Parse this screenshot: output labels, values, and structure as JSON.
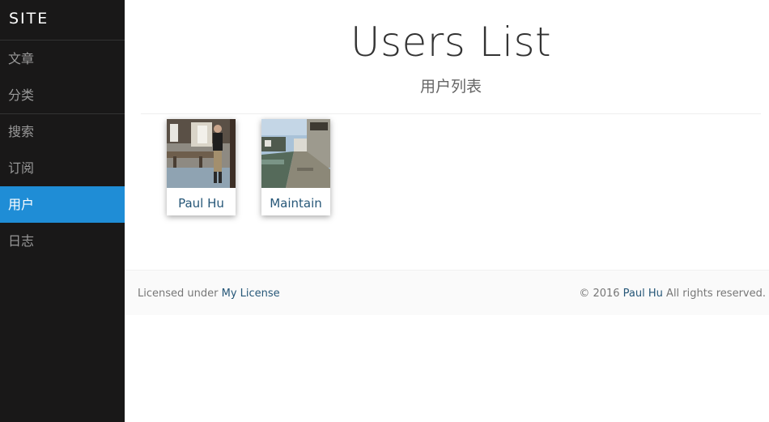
{
  "site": {
    "brand": "SITE"
  },
  "nav": {
    "items": [
      {
        "label": "文章"
      },
      {
        "label": "分类"
      },
      {
        "label": "搜索"
      },
      {
        "label": "订阅"
      },
      {
        "label": "用户",
        "active": true
      },
      {
        "label": "日志"
      }
    ]
  },
  "page": {
    "title": "Users List",
    "subtitle": "用户列表"
  },
  "users": [
    {
      "name": "Paul Hu"
    },
    {
      "name": "Maintain"
    }
  ],
  "footer": {
    "license_prefix": "Licensed under",
    "license_link": "My License",
    "copyright_prefix": "© 2016",
    "author_link": "Paul Hu",
    "copyright_suffix": "All rights reserved."
  },
  "colors": {
    "sidebar_bg": "#191818",
    "active_bg": "#1f8dd6",
    "link": "#265778"
  }
}
